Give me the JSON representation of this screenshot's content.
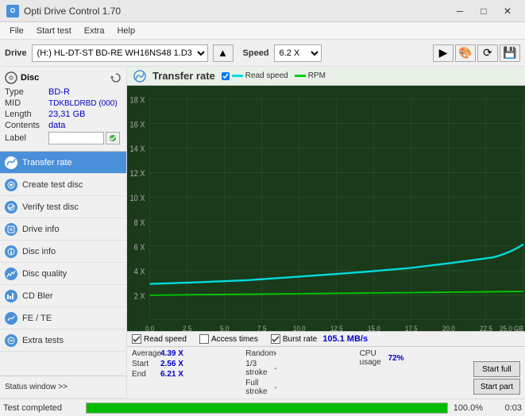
{
  "titlebar": {
    "title": "Opti Drive Control 1.70",
    "icon_label": "O",
    "min_btn": "─",
    "max_btn": "□",
    "close_btn": "✕"
  },
  "menubar": {
    "items": [
      "File",
      "Start test",
      "Extra",
      "Help"
    ]
  },
  "drivebar": {
    "drive_label": "Drive",
    "drive_value": "(H:) HL-DT-ST BD-RE  WH16NS48 1.D3",
    "speed_label": "Speed",
    "speed_value": "6.2 X"
  },
  "toolbar_buttons": [
    "▶",
    "🎨",
    "🔄",
    "💾"
  ],
  "disc": {
    "type_label": "Type",
    "type_value": "BD-R",
    "mid_label": "MID",
    "mid_value": "TDKBLDRBD (000)",
    "length_label": "Length",
    "length_value": "23,31 GB",
    "contents_label": "Contents",
    "contents_value": "data",
    "label_label": "Label",
    "label_value": ""
  },
  "nav": {
    "items": [
      {
        "id": "transfer-rate",
        "label": "Transfer rate",
        "active": true
      },
      {
        "id": "create-test-disc",
        "label": "Create test disc",
        "active": false
      },
      {
        "id": "verify-test-disc",
        "label": "Verify test disc",
        "active": false
      },
      {
        "id": "drive-info",
        "label": "Drive info",
        "active": false
      },
      {
        "id": "disc-info",
        "label": "Disc info",
        "active": false
      },
      {
        "id": "disc-quality",
        "label": "Disc quality",
        "active": false
      },
      {
        "id": "cd-bler",
        "label": "CD Bler",
        "active": false
      },
      {
        "id": "fe-te",
        "label": "FE / TE",
        "active": false
      },
      {
        "id": "extra-tests",
        "label": "Extra tests",
        "active": false
      }
    ],
    "status_window": "Status window >>"
  },
  "chart": {
    "title": "Transfer rate",
    "legend": {
      "read_speed_label": "Read speed",
      "rpm_label": "RPM"
    },
    "y_axis": [
      "18 X",
      "16 X",
      "14 X",
      "12 X",
      "10 X",
      "8 X",
      "6 X",
      "4 X",
      "2 X"
    ],
    "x_axis": [
      "0.0",
      "2.5",
      "5.0",
      "7.5",
      "10.0",
      "12.5",
      "15.0",
      "17.5",
      "20.0",
      "22.5",
      "25.0 GB"
    ]
  },
  "checkboxes": {
    "read_speed": {
      "label": "Read speed",
      "checked": true
    },
    "access_times": {
      "label": "Access times",
      "checked": false
    },
    "burst_rate": {
      "label": "Burst rate",
      "checked": true,
      "value": "105.1 MB/s"
    }
  },
  "stats": {
    "average_label": "Average",
    "average_value": "4.39 X",
    "start_label": "Start",
    "start_value": "2.56 X",
    "end_label": "End",
    "end_value": "6.21 X",
    "random_label": "Random",
    "random_value": "-",
    "stroke1_label": "1/3 stroke",
    "stroke1_value": "-",
    "full_stroke_label": "Full stroke",
    "full_stroke_value": "-",
    "cpu_label": "CPU usage",
    "cpu_value": "72%",
    "btn_full": "Start full",
    "btn_part": "Start part"
  },
  "statusbar": {
    "status_text": "Test completed",
    "progress_pct": "100.0%",
    "time_value": "0:03"
  }
}
